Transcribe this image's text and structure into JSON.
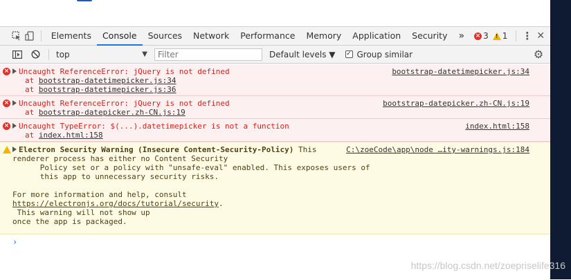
{
  "tabs": [
    {
      "label": "Elements"
    },
    {
      "label": "Console"
    },
    {
      "label": "Performance"
    },
    {
      "label": "Network"
    },
    {
      "label": "Sources"
    },
    {
      "label": "Memory"
    },
    {
      "label": "Application"
    },
    {
      "label": "Security"
    }
  ],
  "tabbar": {
    "tabs": {
      "elements": "Elements",
      "console": "Console",
      "sources": "Sources",
      "network": "Network",
      "performance": "Performance",
      "memory": "Memory",
      "application": "Application",
      "security": "Security"
    },
    "more_tabs": "»",
    "error_count": "3",
    "warning_count": "1",
    "menu": "⋮",
    "close": "✕"
  },
  "filterbar": {
    "context": "top",
    "filter_placeholder": "Filter",
    "levels": "Default levels ▼",
    "group_similar": "Group similar"
  },
  "messages": {
    "error1": {
      "text": "Uncaught ReferenceError: jQuery is not defined",
      "source": "bootstrap-datetimepicker.js:34",
      "stack1": "bootstrap-datetimepicker.js:34",
      "stack2": "bootstrap-datetimepicker.js:36"
    },
    "error2": {
      "text": "Uncaught ReferenceError: jQuery is not defined",
      "source": "bootstrap-datepicker.zh-CN.js:19",
      "stack1": "bootstrap-datepicker.zh-CN.js:19"
    },
    "error3": {
      "text": "Uncaught TypeError: $(...).datetimepicker is not a function",
      "source": "index.html:158",
      "stack1": "index.html:158"
    },
    "warning": {
      "title": "Electron Security Warning (Insecure Content-Security-Policy)",
      "title_rest": " This",
      "source": "C:\\zoeCode\\app\\node …ity-warnings.js:184",
      "line2": "renderer process has either no Content Security",
      "line3": "      Policy set or a policy with \"unsafe-eval\" enabled. This exposes users of",
      "line4": "      this app to unnecessary security risks.",
      "line5": "For more information and help, consult",
      "link": "https://electronjs.org/docs/tutorial/security",
      "link_tail": ".",
      "line7": " This warning will not show up",
      "line8": "once the app is packaged."
    },
    "at_label": "at "
  },
  "prompt_symbol": "›",
  "watermark": "https://blog.csdn.net/zoepriselife316",
  "colors": {
    "accent": "#1a73e8",
    "error_text": "#d4221b",
    "error_bg": "#fdf0f0",
    "warning_bg": "#fefbe5",
    "side_strip": "#0f1a33"
  },
  "icons": [
    "inspect-icon",
    "device-toggle-icon",
    "sidebar-toggle-icon",
    "clear-console-icon",
    "error-icon",
    "warning-icon",
    "settings-gear-icon"
  ]
}
